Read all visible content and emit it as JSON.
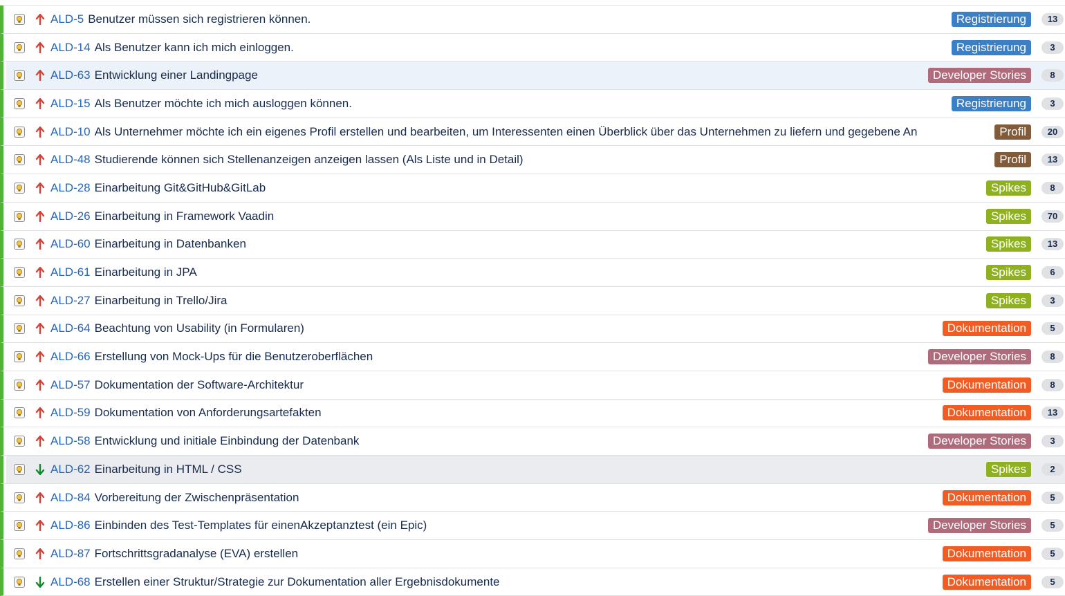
{
  "epic_colors": {
    "Registrierung": "#3b7fc4",
    "Developer Stories": "#b06b7b",
    "Profil": "#815b3a",
    "Spikes": "#8eb021",
    "Dokumentation": "#f15c24"
  },
  "priority_colors": {
    "high": "#d04437",
    "low": "#14892c"
  },
  "rows": [
    {
      "key": "ALD-5",
      "summary": "Benutzer müssen sich registrieren können.",
      "epic": "Registrierung",
      "estimate": "13",
      "priority": "high",
      "highlight": ""
    },
    {
      "key": "ALD-14",
      "summary": "Als Benutzer kann ich mich einloggen.",
      "epic": "Registrierung",
      "estimate": "3",
      "priority": "high",
      "highlight": ""
    },
    {
      "key": "ALD-63",
      "summary": "Entwicklung einer Landingpage",
      "epic": "Developer Stories",
      "estimate": "8",
      "priority": "high",
      "highlight": "blue"
    },
    {
      "key": "ALD-15",
      "summary": "Als Benutzer möchte ich mich ausloggen können.",
      "epic": "Registrierung",
      "estimate": "3",
      "priority": "high",
      "highlight": ""
    },
    {
      "key": "ALD-10",
      "summary": "Als Unternehmer möchte ich ein eigenes Profil erstellen und bearbeiten, um Interessenten einen Überblick über das Unternehmen zu liefern und gegebene An",
      "epic": "Profil",
      "estimate": "20",
      "priority": "high",
      "highlight": ""
    },
    {
      "key": "ALD-48",
      "summary": "Studierende können sich Stellenanzeigen anzeigen lassen (Als Liste und in Detail)",
      "epic": "Profil",
      "estimate": "13",
      "priority": "high",
      "highlight": ""
    },
    {
      "key": "ALD-28",
      "summary": "Einarbeitung Git&GitHub&GitLab",
      "epic": "Spikes",
      "estimate": "8",
      "priority": "high",
      "highlight": ""
    },
    {
      "key": "ALD-26",
      "summary": "Einarbeitung in Framework Vaadin",
      "epic": "Spikes",
      "estimate": "70",
      "priority": "high",
      "highlight": ""
    },
    {
      "key": "ALD-60",
      "summary": "Einarbeitung in Datenbanken",
      "epic": "Spikes",
      "estimate": "13",
      "priority": "high",
      "highlight": ""
    },
    {
      "key": "ALD-61",
      "summary": "Einarbeitung in JPA",
      "epic": "Spikes",
      "estimate": "6",
      "priority": "high",
      "highlight": ""
    },
    {
      "key": "ALD-27",
      "summary": "Einarbeitung in Trello/Jira",
      "epic": "Spikes",
      "estimate": "3",
      "priority": "high",
      "highlight": ""
    },
    {
      "key": "ALD-64",
      "summary": "Beachtung von Usability (in Formularen)",
      "epic": "Dokumentation",
      "estimate": "5",
      "priority": "high",
      "highlight": ""
    },
    {
      "key": "ALD-66",
      "summary": "Erstellung von Mock-Ups für die Benutzeroberflächen",
      "epic": "Developer Stories",
      "estimate": "8",
      "priority": "high",
      "highlight": ""
    },
    {
      "key": "ALD-57",
      "summary": "Dokumentation der Software-Architektur",
      "epic": "Dokumentation",
      "estimate": "8",
      "priority": "high",
      "highlight": ""
    },
    {
      "key": "ALD-59",
      "summary": "Dokumentation von Anforderungsartefakten",
      "epic": "Dokumentation",
      "estimate": "13",
      "priority": "high",
      "highlight": ""
    },
    {
      "key": "ALD-58",
      "summary": "Entwicklung und initiale Einbindung der Datenbank",
      "epic": "Developer Stories",
      "estimate": "3",
      "priority": "high",
      "highlight": ""
    },
    {
      "key": "ALD-62",
      "summary": "Einarbeitung in HTML / CSS",
      "epic": "Spikes",
      "estimate": "2",
      "priority": "low",
      "highlight": "gray"
    },
    {
      "key": "ALD-84",
      "summary": "Vorbereitung der Zwischenpräsentation",
      "epic": "Dokumentation",
      "estimate": "5",
      "priority": "high",
      "highlight": ""
    },
    {
      "key": "ALD-86",
      "summary": "Einbinden des Test-Templates für einenAkzeptanztest (ein Epic)",
      "epic": "Developer Stories",
      "estimate": "5",
      "priority": "high",
      "highlight": ""
    },
    {
      "key": "ALD-87",
      "summary": "Fortschrittsgradanalyse (EVA) erstellen",
      "epic": "Dokumentation",
      "estimate": "5",
      "priority": "high",
      "highlight": ""
    },
    {
      "key": "ALD-68",
      "summary": "Erstellen einer Struktur/Strategie zur Dokumentation aller Ergebnisdokumente",
      "epic": "Dokumentation",
      "estimate": "5",
      "priority": "low",
      "highlight": ""
    }
  ]
}
